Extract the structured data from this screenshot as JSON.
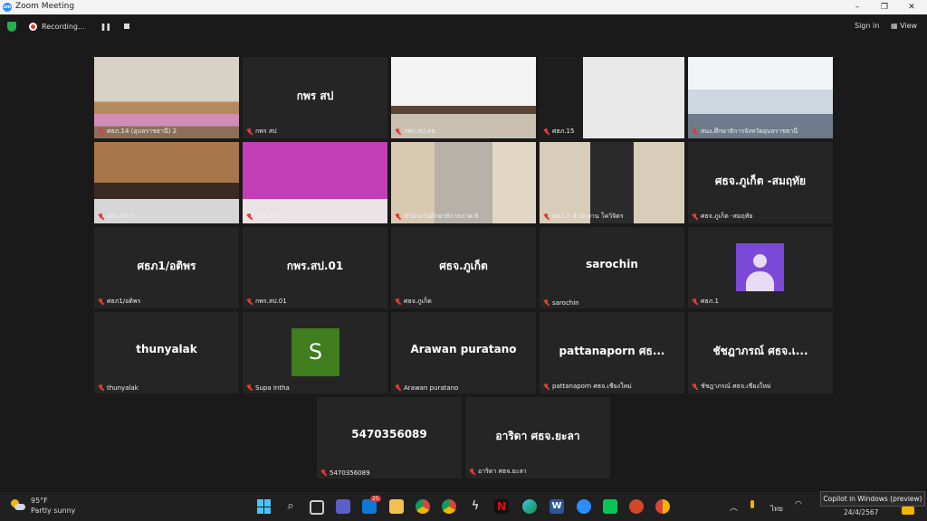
{
  "window": {
    "title": "Zoom Meeting",
    "minimize": "–",
    "maximize": "❐",
    "close": "✕"
  },
  "toolbar": {
    "recording_label": "Recording...",
    "pause_icon": "pause-icon",
    "stop_icon": "stop-icon",
    "sign_in": "Sign in",
    "view": "View"
  },
  "tiles": [
    {
      "name": "ศธภ.14 (อุบลราชธานี) 2",
      "video": true
    },
    {
      "name": "กพร สป",
      "display": "กพร สป",
      "video": false
    },
    {
      "name": "กพร.สป.ศธ.",
      "video": true,
      "active": true
    },
    {
      "name": "ศธภ.15",
      "video": true
    },
    {
      "name": "สนง.ศึกษาธิการจังหวัดอุบลราชธานี",
      "video": true
    },
    {
      "name": "ศธจ.พังงา",
      "video": true
    },
    {
      "name": "ศธจ.ลำพูน",
      "video": true
    },
    {
      "name": "สำนักงานศึกษาธิการภาค 6",
      "video": true
    },
    {
      "name": "ศธภ.7 สำนักงาน โควิจิตร",
      "video": true
    },
    {
      "name": "ศธจ.ภูเก็ต -สมฤทัย",
      "display": "ศธจ.ภูเก็ต -สมฤทัย",
      "video": false
    },
    {
      "name": "ศธภ1/อติพร",
      "display": "ศธภ1/อติพร",
      "video": false
    },
    {
      "name": "กพร.สป.01",
      "display": "กพร.สป.01",
      "video": false
    },
    {
      "name": "ศธจ.ภูเก็ต",
      "display": "ศธจ.ภูเก็ต",
      "video": false
    },
    {
      "name": "sarochin",
      "display": "sarochin",
      "video": false
    },
    {
      "name": "ศธภ.1",
      "video": false,
      "avatar": "person-avatar"
    },
    {
      "name": "thunyalak",
      "display": "thunyalak",
      "video": false
    },
    {
      "name": "Supa Intha",
      "video": false,
      "initial": "S"
    },
    {
      "name": "Arawan puratano",
      "display": "Arawan puratano",
      "video": false
    },
    {
      "name": "pattanaporn ศธจ.เชียงใหม่",
      "display": "pattanaporn ศธ...",
      "video": false
    },
    {
      "name": "ชัชฎาภรณ์ ศธจ.เชียงใหม่",
      "display": "ชัชฎาภรณ์ ศธจ.เ...",
      "video": false
    },
    {
      "name": "5470356089",
      "display": "5470356089",
      "video": false
    },
    {
      "name": "อาริดา ศธจ.ยะลา",
      "display": "อาริดา ศธจ.ยะลา",
      "video": false
    }
  ],
  "taskbar": {
    "weather_temp": "95°F",
    "weather_desc": "Partly sunny",
    "mail_badge": "25",
    "lang": "ไทย",
    "date": "24/4/2567",
    "apps": [
      "windows-icon",
      "search-icon",
      "task-view-icon",
      "teams-icon",
      "mail-icon",
      "file-explorer-icon",
      "chrome-icon",
      "chrome-icon",
      "capcut-icon",
      "netflix-icon",
      "edge-icon",
      "word-icon",
      "zoom-icon",
      "line-icon",
      "powerpoint-icon",
      "chrome-canary-icon"
    ]
  },
  "tooltip": "Copilot in Windows (preview)",
  "colors": {
    "active_border": "#c5e84a",
    "mute_red": "#e03c31",
    "supa_green": "#3f7d1f",
    "avatar_purple": "#7b48d8"
  }
}
